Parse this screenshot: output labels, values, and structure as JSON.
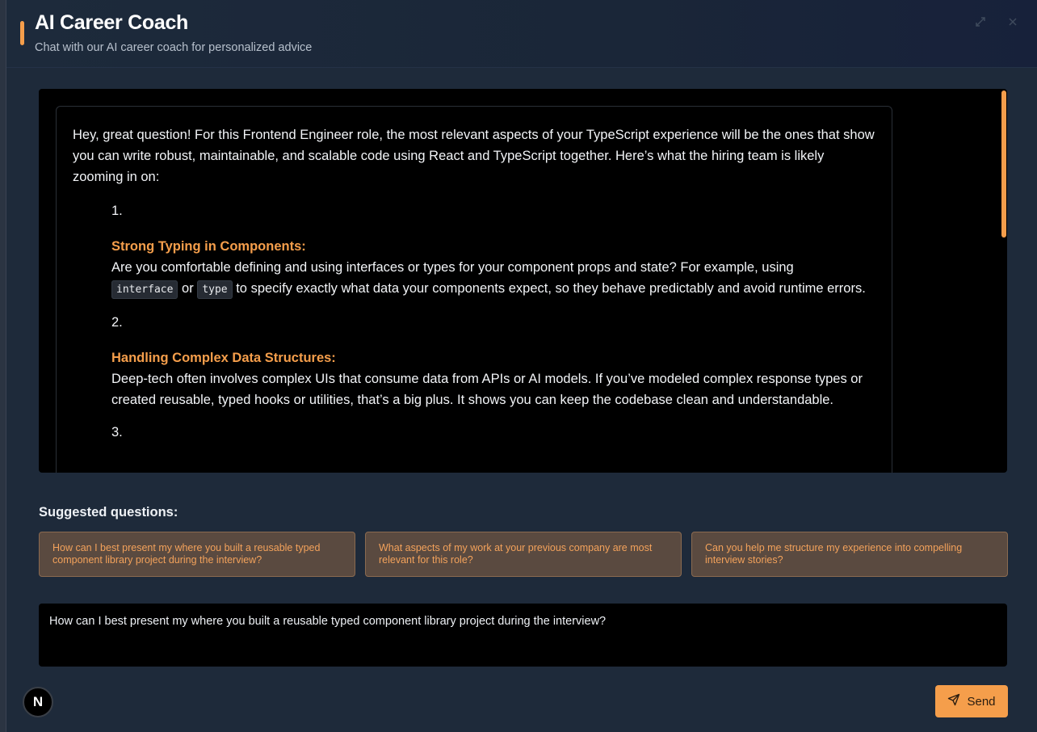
{
  "header": {
    "title": "AI Career Coach",
    "subtitle": "Chat with our AI career coach for personalized advice"
  },
  "message": {
    "intro": "Hey, great question! For this Frontend Engineer role, the most relevant aspects of your TypeScript experience will be the ones that show you can write robust, maintainable, and scalable code using React and TypeScript together. Here’s what the hiring team is likely zooming in on:",
    "items": [
      {
        "number": "1.",
        "title": "Strong Typing in Components:",
        "body_before": "Are you comfortable defining and using interfaces or types for your component props and state? For example, using",
        "code1": "interface",
        "body_mid": "or",
        "code2": "type",
        "body_after": "to specify exactly what data your components expect, so they behave predictably and avoid runtime errors."
      },
      {
        "number": "2.",
        "title": "Handling Complex Data Structures:",
        "body": "Deep-tech often involves complex UIs that consume data from APIs or AI models. If you’ve modeled complex response types or created reusable, typed hooks or utilities, that’s a big plus. It shows you can keep the codebase clean and understandable."
      },
      {
        "number": "3."
      }
    ]
  },
  "suggested": {
    "label": "Suggested questions:",
    "questions": [
      "How can I best present my where you built a reusable typed component library project during the interview?",
      "What aspects of my work at your previous company are most relevant for this role?",
      "Can you help me structure my experience into compelling interview stories?"
    ]
  },
  "input": {
    "value": "How can I best present my where you built a reusable typed component library project during the interview?"
  },
  "badge": {
    "letter": "N"
  },
  "send": {
    "label": "Send"
  },
  "colors": {
    "accent": "#f59e4b",
    "background": "#1e2a3a",
    "panel": "#000000"
  },
  "icons": [
    "expand-icon",
    "close-icon",
    "send-icon"
  ]
}
